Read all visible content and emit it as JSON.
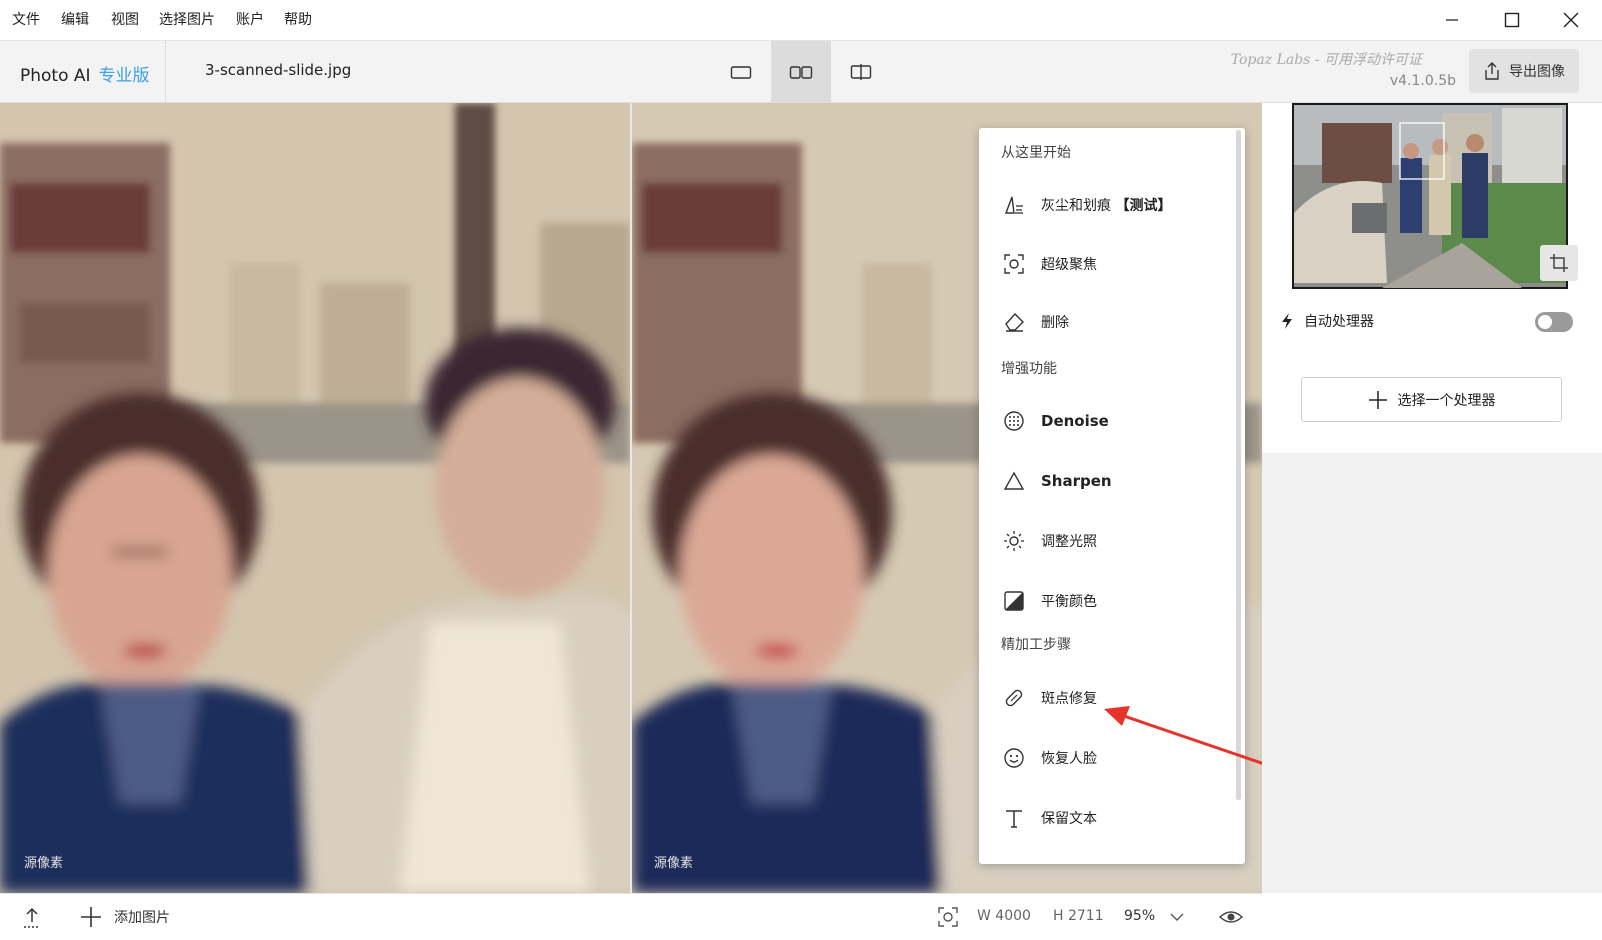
{
  "menubar": {
    "items": [
      "文件",
      "编辑",
      "视图",
      "选择图片",
      "账户",
      "帮助"
    ]
  },
  "window_controls": [
    "minimize-icon",
    "maximize-icon",
    "close-icon"
  ],
  "toolbar": {
    "app_name": "Photo AI",
    "edition": "专业版",
    "filename": "3-scanned-slide.jpg",
    "view_modes": [
      "single-view-icon",
      "side-by-side-icon",
      "split-view-icon"
    ],
    "active_view": "side-by-side",
    "license": "Topaz Labs - 可用浮动许可证",
    "version": "v4.1.0.5b",
    "export_label": "导出图像"
  },
  "canvas": {
    "left_label": "源像素",
    "right_label": "源像素"
  },
  "processor_menu": {
    "sections": [
      {
        "title": "从这里开始",
        "items": [
          {
            "icon": "dust-scratch-icon",
            "label": "灰尘和划痕",
            "tag": "【测试】"
          },
          {
            "icon": "focus-icon",
            "label": "超级聚焦"
          },
          {
            "icon": "eraser-icon",
            "label": "删除"
          }
        ]
      },
      {
        "title": "增强功能",
        "items": [
          {
            "icon": "denoise-icon",
            "label": "Denoise"
          },
          {
            "icon": "sharpen-icon",
            "label": "Sharpen"
          },
          {
            "icon": "light-icon",
            "label": "调整光照"
          },
          {
            "icon": "color-balance-icon",
            "label": "平衡颜色"
          }
        ]
      },
      {
        "title": "精加工步骤",
        "items": [
          {
            "icon": "bandage-icon",
            "label": "斑点修复"
          },
          {
            "icon": "face-icon",
            "label": "恢复人脸"
          },
          {
            "icon": "text-icon",
            "label": "保留文本"
          }
        ]
      }
    ]
  },
  "right_panel": {
    "auto_processor_label": "自动处理器",
    "auto_processor_on": false,
    "select_processor_label": "选择一个处理器"
  },
  "bottombar": {
    "add_image_label": "添加图片",
    "width_label": "W 4000",
    "height_label": "H 2711",
    "zoom": "95%"
  },
  "colors": {
    "accent": "#3ba0e6",
    "annotation_arrow": "#e8332a"
  }
}
